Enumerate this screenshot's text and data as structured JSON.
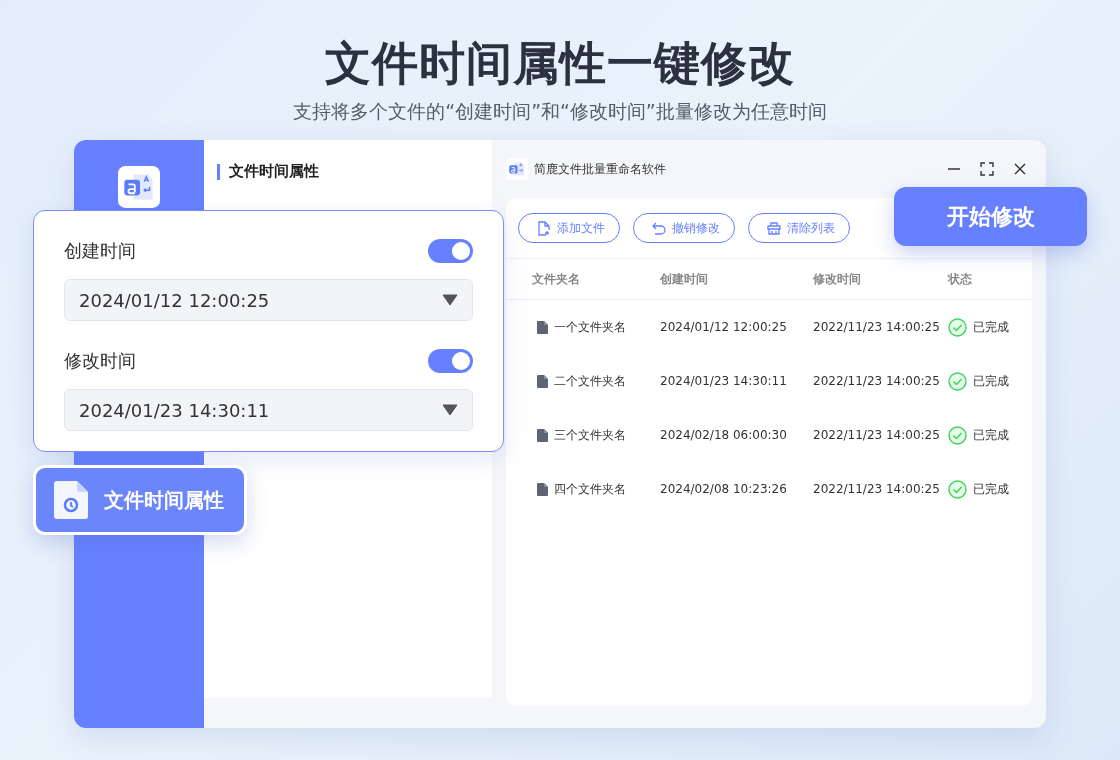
{
  "header": {
    "title": "文件时间属性一键修改",
    "subtitle": "支持将多个文件的“创建时间”和“修改时间”批量修改为任意时间"
  },
  "panel": {
    "title": "文件时间属性"
  },
  "time_settings": [
    {
      "label": "创建时间",
      "on": true,
      "value": "2024/01/12 12:00:25"
    },
    {
      "label": "修改时间",
      "on": true,
      "value": "2024/01/23 14:30:11"
    }
  ],
  "sidebar_tab": {
    "label": "文件时间属性",
    "selected": true
  },
  "window": {
    "title": "简鹿文件批量重命名软件"
  },
  "toolbar": [
    {
      "kind": "add",
      "label": "添加文件"
    },
    {
      "kind": "undo",
      "label": "撤销修改"
    },
    {
      "kind": "clear",
      "label": "清除列表"
    }
  ],
  "start_button": {
    "label": "开始修改"
  },
  "table": {
    "columns": [
      "文件夹名",
      "创建时间",
      "修改时间",
      "状态"
    ],
    "rows": [
      {
        "name": "一个文件夹名",
        "created": "2024/01/12 12:00:25",
        "modified": "2022/11/23 14:00:25",
        "status": "已完成"
      },
      {
        "name": "二个文件夹名",
        "created": "2024/01/23 14:30:11",
        "modified": "2022/11/23 14:00:25",
        "status": "已完成"
      },
      {
        "name": "三个文件夹名",
        "created": "2024/02/18 06:00:30",
        "modified": "2022/11/23 14:00:25",
        "status": "已完成"
      },
      {
        "name": "四个文件夹名",
        "created": "2024/02/08 10:23:26",
        "modified": "2022/11/23 14:00:25",
        "status": "已完成"
      }
    ]
  }
}
